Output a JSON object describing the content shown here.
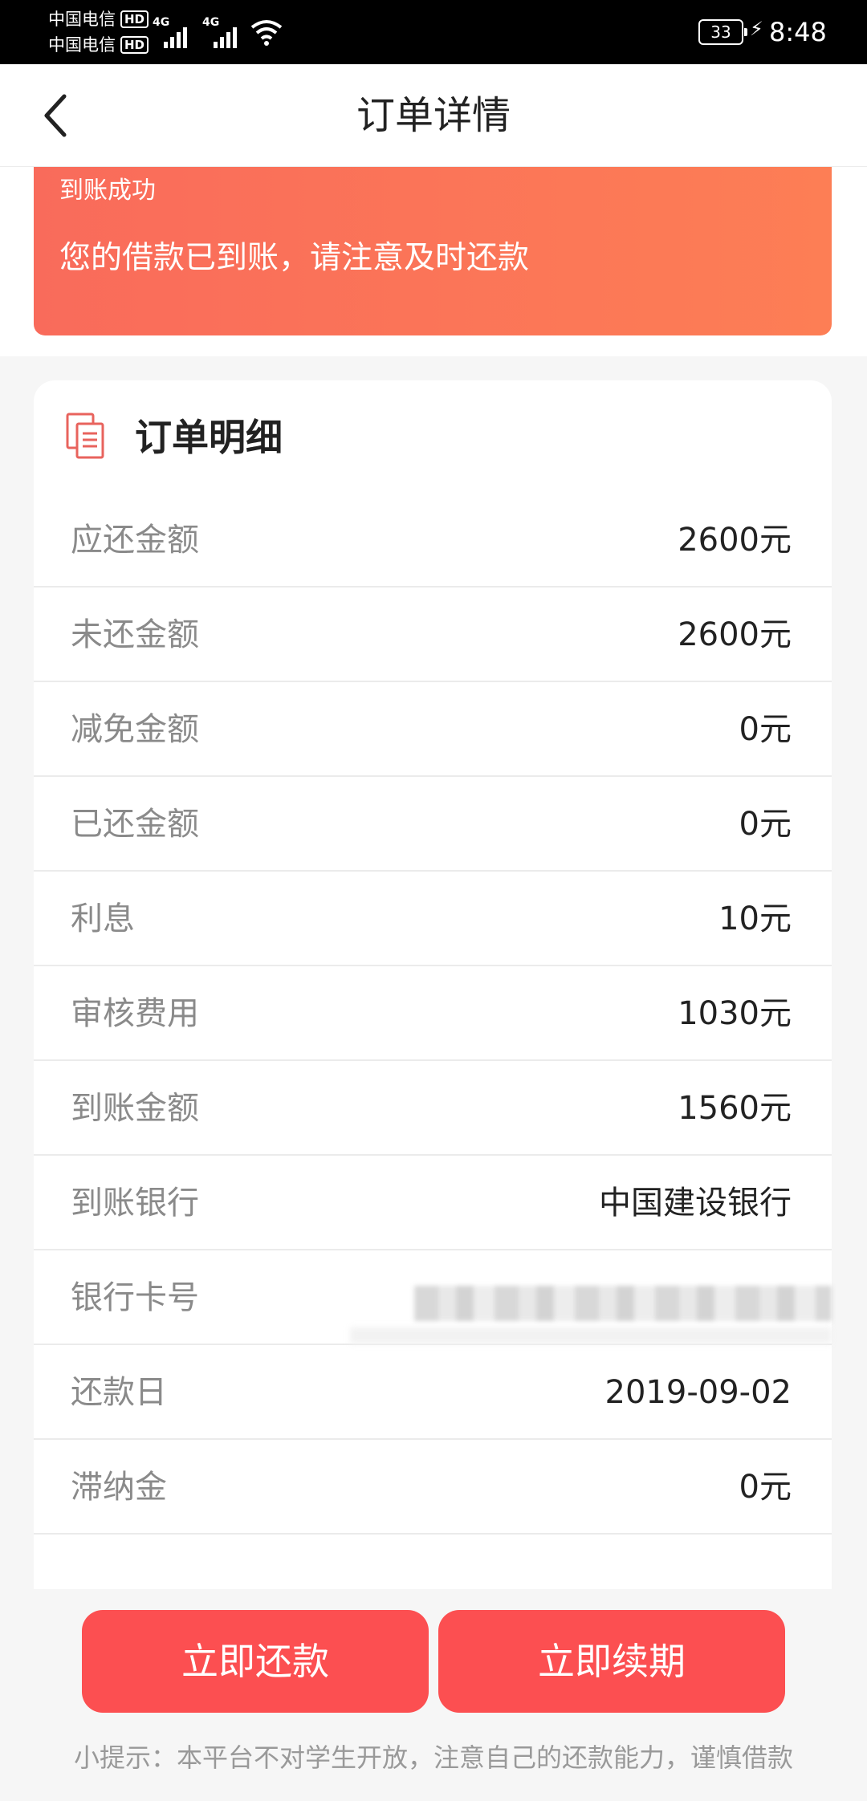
{
  "status_bar": {
    "carrier1": "中国电信",
    "carrier2": "中国电信",
    "hd_badge": "HD",
    "network1": "4G",
    "network2": "4G",
    "battery": "33",
    "time": "8:48"
  },
  "header": {
    "title": "订单详情"
  },
  "banner": {
    "title": "到账成功",
    "message": "您的借款已到账，请注意及时还款"
  },
  "details": {
    "title": "订单明细",
    "rows": [
      {
        "label": "应还金额",
        "value": "2600元"
      },
      {
        "label": "未还金额",
        "value": "2600元"
      },
      {
        "label": "减免金额",
        "value": "0元"
      },
      {
        "label": "已还金额",
        "value": "0元"
      },
      {
        "label": "利息",
        "value": "10元"
      },
      {
        "label": "审核费用",
        "value": "1030元"
      },
      {
        "label": "到账金额",
        "value": "1560元"
      },
      {
        "label": "到账银行",
        "value": "中国建设银行"
      },
      {
        "label": "银行卡号",
        "value": ""
      },
      {
        "label": "还款日",
        "value": "2019-09-02"
      },
      {
        "label": "滞纳金",
        "value": "0元"
      }
    ]
  },
  "actions": {
    "repay_label": "立即还款",
    "renew_label": "立即续期"
  },
  "tip": "小提示：本平台不对学生开放，注意自己的还款能力，谨慎借款",
  "colors": {
    "banner_start": "#f96b5b",
    "banner_end": "#fd7e55",
    "button": "#fc4f51",
    "icon": "#e8635d"
  }
}
